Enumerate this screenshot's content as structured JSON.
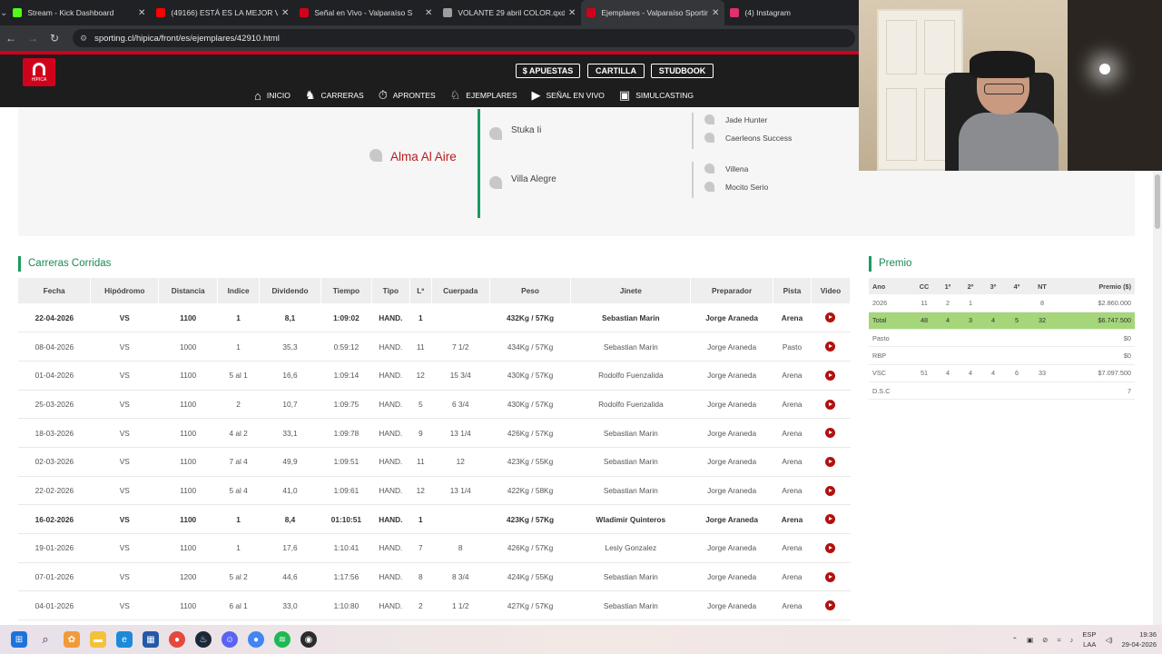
{
  "browser": {
    "tabs": [
      {
        "title": "Stream - Kick Dashboard",
        "favicon_color": "#53fc18",
        "active": false
      },
      {
        "title": "(49166) ESTÁ ES LA MEJOR VE",
        "favicon_color": "#ff0000",
        "active": false
      },
      {
        "title": "Señal en Vivo - Valparaíso S",
        "favicon_color": "#d0021b",
        "active": false
      },
      {
        "title": "VOLANTE 29 abril COLOR.qxd",
        "favicon_color": "#9e9e9e",
        "active": false
      },
      {
        "title": "Ejemplares - Valparaíso Sportin",
        "favicon_color": "#d0021b",
        "active": true
      },
      {
        "title": "(4) Instagram",
        "favicon_color": "#e1306c",
        "active": false
      }
    ],
    "url": "sporting.cl/hipica/front/es/ejemplares/42910.html"
  },
  "site": {
    "logo_text": "HÍPICA",
    "top_buttons": [
      "$ APUESTAS",
      "CARTILLA",
      "STUDBOOK"
    ],
    "nav": [
      {
        "label": "INICIO",
        "icon": "home-icon",
        "glyph": "⌂"
      },
      {
        "label": "CARRERAS",
        "icon": "horse-icon",
        "glyph": "♞"
      },
      {
        "label": "APRONTES",
        "icon": "stopwatch-icon",
        "glyph": "⏱"
      },
      {
        "label": "EJEMPLARES",
        "icon": "horse-head-icon",
        "glyph": "♘"
      },
      {
        "label": "SEÑAL EN VIVO",
        "icon": "play-circle-icon",
        "glyph": "▶"
      },
      {
        "label": "SIMULCASTING",
        "icon": "screen-icon",
        "glyph": "▣"
      }
    ],
    "active_nav": "EJEMPLARES",
    "accent_color": "#d0021b"
  },
  "pedigree": {
    "horse": "Alma Al Aire",
    "sire": "Stuka Ii",
    "dam": "Villa Alegre",
    "sire_sire": "Jade Hunter",
    "sire_dam": "Caerleons Success",
    "dam_sire": "Villena",
    "dam_dam": "Mocito Serio"
  },
  "races": {
    "title": "Carreras Corridas",
    "columns": [
      "Fecha",
      "Hipódromo",
      "Distancia",
      "Indice",
      "Dividendo",
      "Tiempo",
      "Tipo",
      "Lº",
      "Cuerpada",
      "Peso",
      "Jinete",
      "Preparador",
      "Pista",
      "Video"
    ],
    "rows": [
      {
        "fecha": "22-04-2026",
        "hipodromo": "VS",
        "distancia": "1100",
        "indice": "1",
        "dividendo": "8,1",
        "tiempo": "1:09:02",
        "tipo": "HAND.",
        "lugar": "1",
        "cuerpada": "",
        "peso": "432Kg / 57Kg",
        "jinete": "Sebastian Marin",
        "preparador": "Jorge Araneda",
        "pista": "Arena",
        "bold": true
      },
      {
        "fecha": "08-04-2026",
        "hipodromo": "VS",
        "distancia": "1000",
        "indice": "1",
        "dividendo": "35,3",
        "tiempo": "0:59:12",
        "tipo": "HAND.",
        "lugar": "11",
        "cuerpada": "7 1/2",
        "peso": "434Kg / 57Kg",
        "jinete": "Sebastian Marin",
        "preparador": "Jorge Araneda",
        "pista": "Pasto",
        "bold": false
      },
      {
        "fecha": "01-04-2026",
        "hipodromo": "VS",
        "distancia": "1100",
        "indice": "5 al 1",
        "dividendo": "16,6",
        "tiempo": "1:09:14",
        "tipo": "HAND.",
        "lugar": "12",
        "cuerpada": "15 3/4",
        "peso": "430Kg / 57Kg",
        "jinete": "Rodolfo Fuenzalida",
        "preparador": "Jorge Araneda",
        "pista": "Arena",
        "bold": false
      },
      {
        "fecha": "25-03-2026",
        "hipodromo": "VS",
        "distancia": "1100",
        "indice": "2",
        "dividendo": "10,7",
        "tiempo": "1:09:75",
        "tipo": "HAND.",
        "lugar": "5",
        "cuerpada": "6 3/4",
        "peso": "430Kg / 57Kg",
        "jinete": "Rodolfo Fuenzalida",
        "preparador": "Jorge Araneda",
        "pista": "Arena",
        "bold": false
      },
      {
        "fecha": "18-03-2026",
        "hipodromo": "VS",
        "distancia": "1100",
        "indice": "4 al 2",
        "dividendo": "33,1",
        "tiempo": "1:09:78",
        "tipo": "HAND.",
        "lugar": "9",
        "cuerpada": "13 1/4",
        "peso": "426Kg / 57Kg",
        "jinete": "Sebastian Marin",
        "preparador": "Jorge Araneda",
        "pista": "Arena",
        "bold": false
      },
      {
        "fecha": "02-03-2026",
        "hipodromo": "VS",
        "distancia": "1100",
        "indice": "7 al 4",
        "dividendo": "49,9",
        "tiempo": "1:09:51",
        "tipo": "HAND.",
        "lugar": "11",
        "cuerpada": "12",
        "peso": "423Kg / 55Kg",
        "jinete": "Sebastian Marin",
        "preparador": "Jorge Araneda",
        "pista": "Arena",
        "bold": false
      },
      {
        "fecha": "22-02-2026",
        "hipodromo": "VS",
        "distancia": "1100",
        "indice": "5 al 4",
        "dividendo": "41,0",
        "tiempo": "1:09:61",
        "tipo": "HAND.",
        "lugar": "12",
        "cuerpada": "13 1/4",
        "peso": "422Kg / 58Kg",
        "jinete": "Sebastian Marin",
        "preparador": "Jorge Araneda",
        "pista": "Arena",
        "bold": false
      },
      {
        "fecha": "16-02-2026",
        "hipodromo": "VS",
        "distancia": "1100",
        "indice": "1",
        "dividendo": "8,4",
        "tiempo": "01:10:51",
        "tipo": "HAND.",
        "lugar": "1",
        "cuerpada": "",
        "peso": "423Kg / 57Kg",
        "jinete": "Wladimir Quinteros",
        "preparador": "Jorge Araneda",
        "pista": "Arena",
        "bold": true
      },
      {
        "fecha": "19-01-2026",
        "hipodromo": "VS",
        "distancia": "1100",
        "indice": "1",
        "dividendo": "17,6",
        "tiempo": "1:10:41",
        "tipo": "HAND.",
        "lugar": "7",
        "cuerpada": "8",
        "peso": "426Kg / 57Kg",
        "jinete": "Lesly Gonzalez",
        "preparador": "Jorge Araneda",
        "pista": "Arena",
        "bold": false
      },
      {
        "fecha": "07-01-2026",
        "hipodromo": "VS",
        "distancia": "1200",
        "indice": "5 al 2",
        "dividendo": "44,6",
        "tiempo": "1:17:56",
        "tipo": "HAND.",
        "lugar": "8",
        "cuerpada": "8 3/4",
        "peso": "424Kg / 55Kg",
        "jinete": "Sebastian Marin",
        "preparador": "Jorge Araneda",
        "pista": "Arena",
        "bold": false
      },
      {
        "fecha": "04-01-2026",
        "hipodromo": "VS",
        "distancia": "1100",
        "indice": "6 al 1",
        "dividendo": "33,0",
        "tiempo": "1:10:80",
        "tipo": "HAND.",
        "lugar": "2",
        "cuerpada": "1 1/2",
        "peso": "427Kg / 57Kg",
        "jinete": "Sebastian Marin",
        "preparador": "Jorge Araneda",
        "pista": "Arena",
        "bold": false
      }
    ]
  },
  "premio": {
    "title": "Premio",
    "columns": [
      "Ano",
      "CC",
      "1º",
      "2º",
      "3º",
      "4º",
      "NT",
      "Premio ($)"
    ],
    "rows": [
      {
        "ano": "2026",
        "cc": "11",
        "p1": "2",
        "p2": "1",
        "p3": "",
        "p4": "",
        "nt": "8",
        "premio": "$2.860.000",
        "total": false
      },
      {
        "ano": "Total",
        "cc": "48",
        "p1": "4",
        "p2": "3",
        "p3": "4",
        "p4": "5",
        "nt": "32",
        "premio": "$6.747.500",
        "total": true
      },
      {
        "ano": "Pasto",
        "cc": "",
        "p1": "",
        "p2": "",
        "p3": "",
        "p4": "",
        "nt": "",
        "premio": "$0",
        "total": false
      },
      {
        "ano": "RBP",
        "cc": "",
        "p1": "",
        "p2": "",
        "p3": "",
        "p4": "",
        "nt": "",
        "premio": "$0",
        "total": false
      },
      {
        "ano": "VSC",
        "cc": "51",
        "p1": "4",
        "p2": "4",
        "p3": "4",
        "p4": "6",
        "nt": "33",
        "premio": "$7.097.500",
        "total": false
      },
      {
        "ano": "D.S.C",
        "cc": "",
        "p1": "",
        "p2": "",
        "p3": "",
        "p4": "",
        "nt": "",
        "premio": "7",
        "total": false
      }
    ]
  },
  "taskbar": {
    "tray_lang": "ESP",
    "tray_lang2": "LAA",
    "time": "19:36",
    "date": "29-04-2026"
  }
}
